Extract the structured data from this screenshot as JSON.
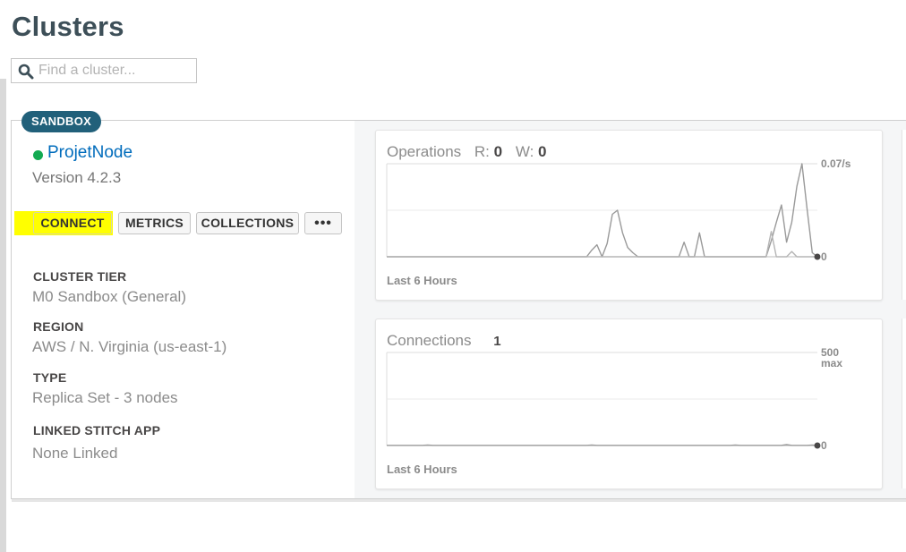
{
  "page": {
    "title": "Clusters"
  },
  "search": {
    "placeholder": "Find a cluster...",
    "icon": "search-icon"
  },
  "cluster": {
    "badge": "SANDBOX",
    "status_color": "#13aa52",
    "name": "ProjetNode",
    "version": "Version 4.2.3",
    "buttons": {
      "connect": "CONNECT",
      "metrics": "METRICS",
      "collections": "COLLECTIONS",
      "more": "•••"
    },
    "fields": [
      {
        "label": "CLUSTER TIER",
        "value": "M0 Sandbox (General)"
      },
      {
        "label": "REGION",
        "value": "AWS / N. Virginia (us-east-1)"
      },
      {
        "label": "TYPE",
        "value": "Replica Set - 3 nodes"
      },
      {
        "label": "LINKED STITCH APP",
        "value": "None Linked"
      }
    ]
  },
  "operations_chart": {
    "title": "Operations",
    "r_label": "R:",
    "r_value": "0",
    "w_label": "W:",
    "w_value": "0",
    "max_label": "0.07/s",
    "zero_label": "0",
    "footer": "Last 6 Hours"
  },
  "connections_chart": {
    "title": "Connections",
    "value": "1",
    "max_label": "500",
    "max_suffix": "max",
    "zero_label": "0",
    "footer": "Last 6 Hours"
  },
  "chart_data": [
    {
      "type": "line",
      "title": "Operations",
      "xlabel": "Last 6 Hours",
      "ylim": [
        0,
        0.07
      ],
      "series": [
        {
          "values": [
            0,
            0,
            0,
            0,
            0,
            0,
            0,
            0,
            0,
            0,
            0,
            0,
            0,
            0,
            0,
            0,
            0,
            0,
            0,
            0,
            0,
            0,
            0,
            0,
            0,
            0,
            0,
            0,
            0,
            0,
            0,
            0,
            0,
            0,
            0,
            0,
            0,
            0,
            0,
            0,
            0.005,
            0.009,
            0,
            0.01,
            0.032,
            0.035,
            0.018,
            0.007,
            0.003,
            0,
            0,
            0,
            0,
            0,
            0,
            0,
            0,
            0,
            0.011,
            0,
            0,
            0.018,
            0,
            0,
            0,
            0,
            0,
            0,
            0,
            0,
            0,
            0,
            0,
            0,
            0,
            0.012,
            0.026,
            0.039,
            0.011,
            0.026,
            0.053,
            0.07,
            0.036,
            0.003,
            0
          ]
        },
        {
          "values": [
            0,
            0,
            0,
            0,
            0,
            0,
            0,
            0,
            0,
            0,
            0,
            0,
            0,
            0,
            0,
            0,
            0,
            0,
            0,
            0,
            0,
            0,
            0,
            0,
            0,
            0,
            0,
            0,
            0,
            0,
            0,
            0,
            0,
            0,
            0,
            0,
            0,
            0,
            0,
            0,
            0,
            0,
            0,
            0,
            0,
            0,
            0,
            0,
            0,
            0,
            0,
            0,
            0,
            0,
            0,
            0,
            0,
            0,
            0,
            0,
            0,
            0,
            0,
            0,
            0,
            0,
            0,
            0,
            0,
            0,
            0,
            0,
            0,
            0,
            0,
            0.019,
            0,
            0,
            0,
            0.004,
            0,
            0,
            0,
            0,
            0
          ]
        }
      ],
      "grid": true
    },
    {
      "type": "line",
      "title": "Connections",
      "xlabel": "Last 6 Hours",
      "ylim": [
        0,
        500
      ],
      "series": [
        {
          "values": [
            1,
            1,
            1,
            1,
            1,
            1,
            1,
            1,
            3,
            1,
            1,
            1,
            1,
            1,
            1,
            1,
            1,
            1,
            1,
            1,
            1,
            1,
            1,
            1,
            1,
            1,
            1,
            1,
            1,
            1,
            1,
            1,
            1,
            1,
            1,
            1,
            1,
            1,
            1,
            1,
            3,
            1,
            1,
            1,
            1,
            1,
            1,
            1,
            1,
            1,
            1,
            1,
            1,
            1,
            1,
            1,
            1,
            1,
            1,
            1,
            1,
            1,
            1,
            1,
            1,
            1,
            1,
            1,
            3,
            1,
            1,
            1,
            1,
            1,
            1,
            1,
            1,
            1,
            5,
            1,
            1,
            1,
            1,
            3,
            1
          ]
        }
      ],
      "grid": true
    }
  ]
}
